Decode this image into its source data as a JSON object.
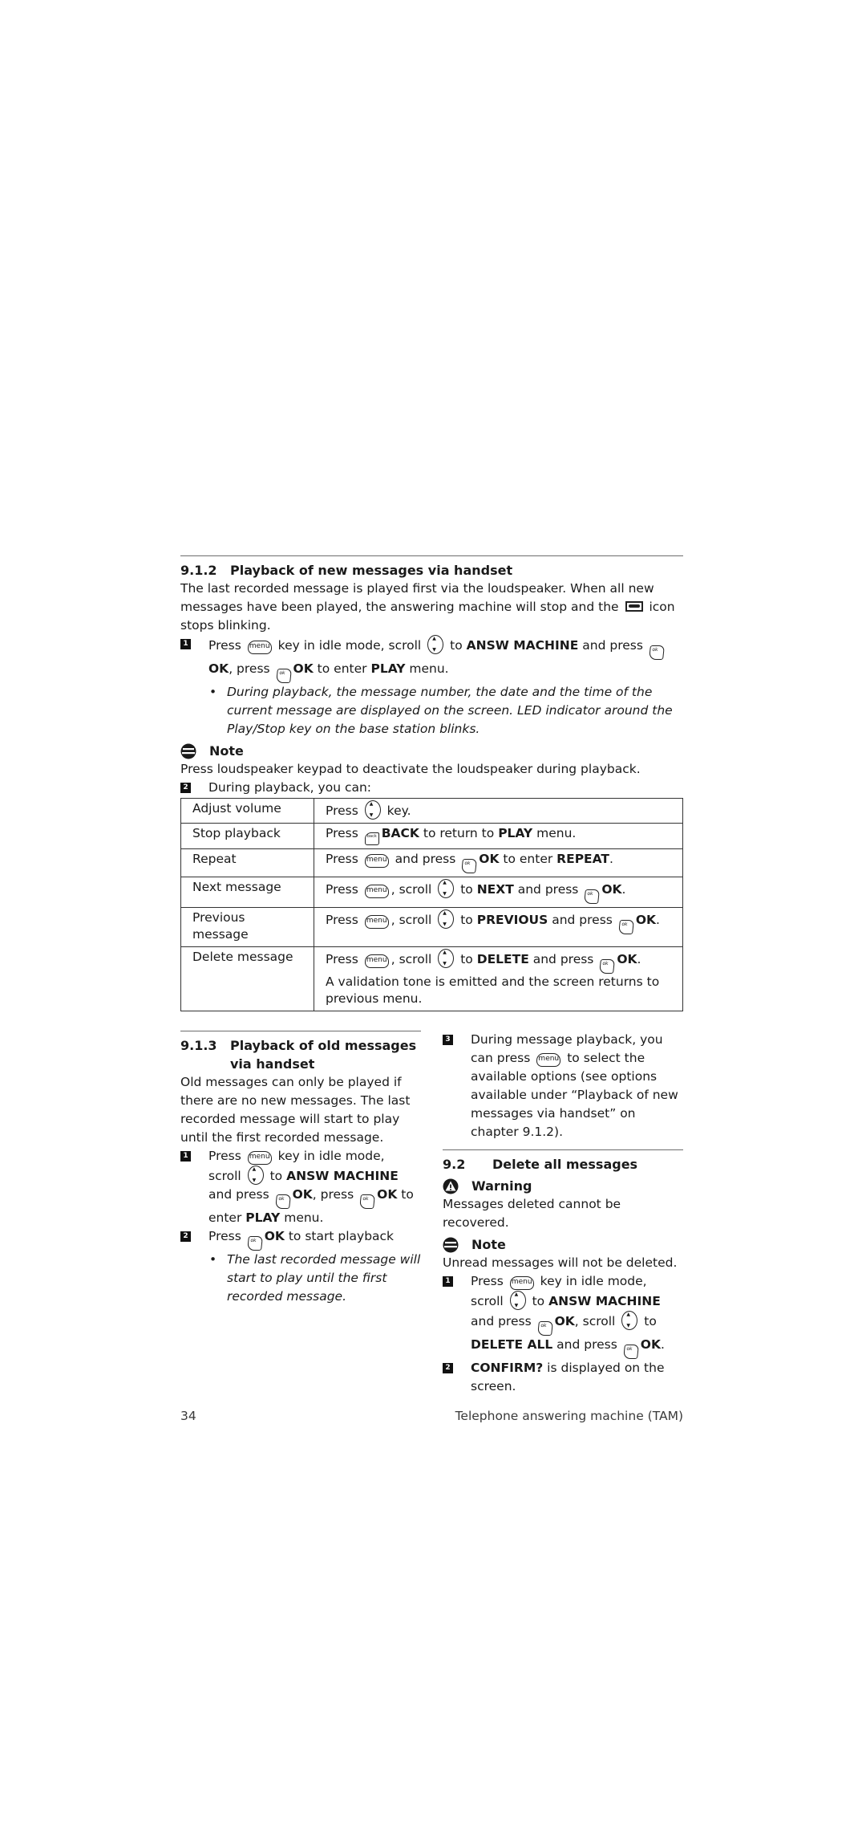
{
  "section_912": {
    "number": "9.1.2",
    "title": "Playback of new messages via handset",
    "intro_1": "The last recorded message is played first via the loudspeaker. When all new messages have been played, the answering machine will stop and the",
    "intro_2": "icon stops blinking.",
    "step1": {
      "badge": "1",
      "t1": "Press",
      "t2": "key in idle mode, scroll",
      "t3": "to",
      "b1": "ANSW MACHINE",
      "t4": "and press",
      "b2": "OK",
      "t5": ", press",
      "b3": "OK",
      "t6": "to enter",
      "b4": "PLAY",
      "t7": "menu."
    },
    "bullet": "During playback, the message number, the date and the time of the current message are displayed on the screen. LED indicator around the Play/Stop key on the base station blinks.",
    "note_label": "Note",
    "note_text": "Press loudspeaker keypad to deactivate the loudspeaker during playback.",
    "step2": {
      "badge": "2",
      "text": "During playback, you can:"
    },
    "table": [
      {
        "action": "Adjust volume",
        "p1": "Press",
        "p2": "key."
      },
      {
        "action": "Stop playback",
        "p1": "Press",
        "b1": "BACK",
        "p2": "to return to",
        "b2": "PLAY",
        "p3": "menu."
      },
      {
        "action": "Repeat",
        "p1": "Press",
        "p2": "and press",
        "b1": "OK",
        "p3": "to enter",
        "b2": "REPEAT",
        "p4": "."
      },
      {
        "action": "Next message",
        "p1": "Press",
        "p2": ", scroll",
        "p3": "to",
        "b1": "NEXT",
        "p4": "and press",
        "b2": "OK",
        "p5": "."
      },
      {
        "action": "Previous message",
        "p1": "Press",
        "p2": ", scroll",
        "p3": "to",
        "b1": "PREVIOUS",
        "p4": "and press",
        "b2": "OK",
        "p5": "."
      },
      {
        "action": "Delete message",
        "p1": "Press",
        "p2": ", scroll",
        "p3": "to",
        "b1": "DELETE",
        "p4": "and press",
        "b2": "OK",
        "p5": ".",
        "extra": "A validation tone is emitted and the screen returns to previous menu."
      }
    ]
  },
  "section_913": {
    "number": "9.1.3",
    "title": "Playback of old messages via handset",
    "intro": "Old messages can only be played if there are no new messages. The last recorded message will start to play until the first recorded message.",
    "step1": {
      "badge": "1",
      "t1": "Press",
      "t2": "key in idle mode, scroll",
      "t3": "to",
      "b1": "ANSW MACHINE",
      "t4": "and press",
      "b2": "OK",
      "t5": ", press",
      "b3": "OK",
      "t6": "to enter",
      "b4": "PLAY",
      "t7": "menu."
    },
    "step2": {
      "badge": "2",
      "t1": "Press",
      "b1": "OK",
      "t2": "to start playback"
    },
    "bullet": "The last recorded message will start to play until the first recorded message.",
    "step3": {
      "badge": "3",
      "t1": "During message playback, you can press",
      "t2": "to select the available options (see options available under “Playback of new messages via handset” on chapter 9.1.2)."
    }
  },
  "section_92": {
    "number": "9.2",
    "title": "Delete all messages",
    "warning_label": "Warning",
    "warning_text": "Messages deleted cannot be recovered.",
    "note_label": "Note",
    "note_text": "Unread messages will not be deleted.",
    "step1": {
      "badge": "1",
      "t1": "Press",
      "t2": "key in idle mode, scroll",
      "t3": "to",
      "b1": "ANSW MACHINE",
      "t4": "and press",
      "b2": "OK",
      "t5": ", scroll",
      "t6": "to",
      "b3": "DELETE ALL",
      "t7": "and press",
      "b4": "OK",
      "t8": "."
    },
    "step2": {
      "badge": "2",
      "b1": "CONFIRM?",
      "t1": "is displayed on the screen."
    }
  },
  "keys": {
    "menu": "menu",
    "ok": "OK",
    "back": "back"
  },
  "footer": {
    "page_number": "34",
    "chapter": "Telephone answering machine (TAM)"
  }
}
